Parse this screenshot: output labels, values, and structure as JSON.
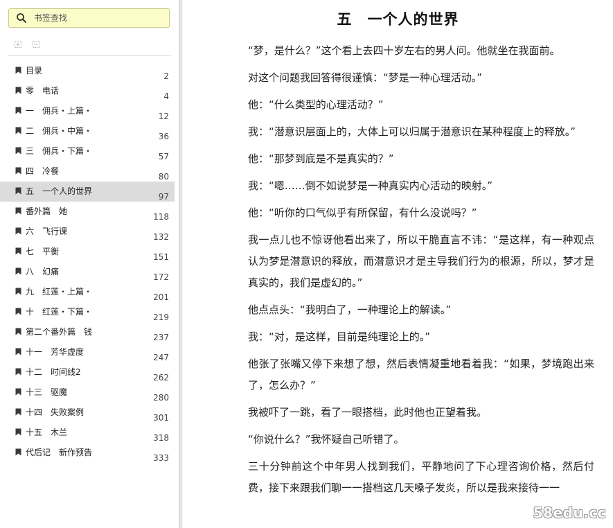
{
  "search": {
    "placeholder": "书签查找"
  },
  "toolbar": {
    "expand_icon": "expand-all-icon",
    "collapse_icon": "collapse-all-icon"
  },
  "toc": [
    {
      "label": "目录",
      "page": "2"
    },
    {
      "label": "零　电话",
      "page": "4"
    },
    {
      "label": "一　佣兵・上篇・",
      "page": "12"
    },
    {
      "label": "二　佣兵・中篇・",
      "page": "36"
    },
    {
      "label": "三　佣兵・下篇・",
      "page": "57"
    },
    {
      "label": "四　冷餐",
      "page": "80"
    },
    {
      "label": "五　一个人的世界",
      "page": "97"
    },
    {
      "label": "番外篇　她",
      "page": "118"
    },
    {
      "label": "六　飞行课",
      "page": "132"
    },
    {
      "label": "七　平衡",
      "page": "151"
    },
    {
      "label": "八　幻痛",
      "page": "172"
    },
    {
      "label": "九　红莲・上篇・",
      "page": "201"
    },
    {
      "label": "十　红莲・下篇・",
      "page": "219"
    },
    {
      "label": "第二个番外篇　钱",
      "page": "237"
    },
    {
      "label": "十一　芳华虚度",
      "page": "247"
    },
    {
      "label": "十二　时间线2",
      "page": "262"
    },
    {
      "label": "十三　驱魔",
      "page": "280"
    },
    {
      "label": "十四　失败案例",
      "page": "301"
    },
    {
      "label": "十五　木兰",
      "page": "318"
    },
    {
      "label": "代后记　新作预告",
      "page": "333"
    }
  ],
  "active_index": 6,
  "chapter": {
    "title": "五　一个人的世界",
    "paragraphs": [
      "“梦，是什么？”这个看上去四十岁左右的男人问。他就坐在我面前。",
      "对这个问题我回答得很谨慎：“梦是一种心理活动。”",
      "他：“什么类型的心理活动？”",
      "我：“潜意识层面上的，大体上可以归属于潜意识在某种程度上的释放。”",
      "他：“那梦到底是不是真实的？”",
      "我：“嗯……倒不如说梦是一种真实内心活动的映射。”",
      "他：“听你的口气似乎有所保留，有什么没说吗？”",
      "我一点儿也不惊讶他看出来了，所以干脆直言不讳：“是这样，有一种观点认为梦是潜意识的释放，而潜意识才是主导我们行为的根源，所以，梦才是真实的，我们是虚幻的。”",
      "他点点头：“我明白了，一种理论上的解读。”",
      "我：“对，是这样，目前是纯理论上的。”",
      "他张了张嘴又停下来想了想，然后表情凝重地看着我：“如果，梦境跑出来了，怎么办？”",
      "我被吓了一跳，看了一眼搭档，此时他也正望着我。",
      "“你说什么？”我怀疑自己听错了。",
      "三十分钟前这个中年男人找到我们，平静地问了下心理咨询价格，然后付费，接下来跟我们聊一一搭档这几天嗓子发炎，所以是我来接待一一"
    ]
  },
  "watermark": "58edu.cc",
  "colors": {
    "search_bg": "#fbfcc8",
    "active_row": "#dcdcdc",
    "divider": "#e4e4e4"
  }
}
